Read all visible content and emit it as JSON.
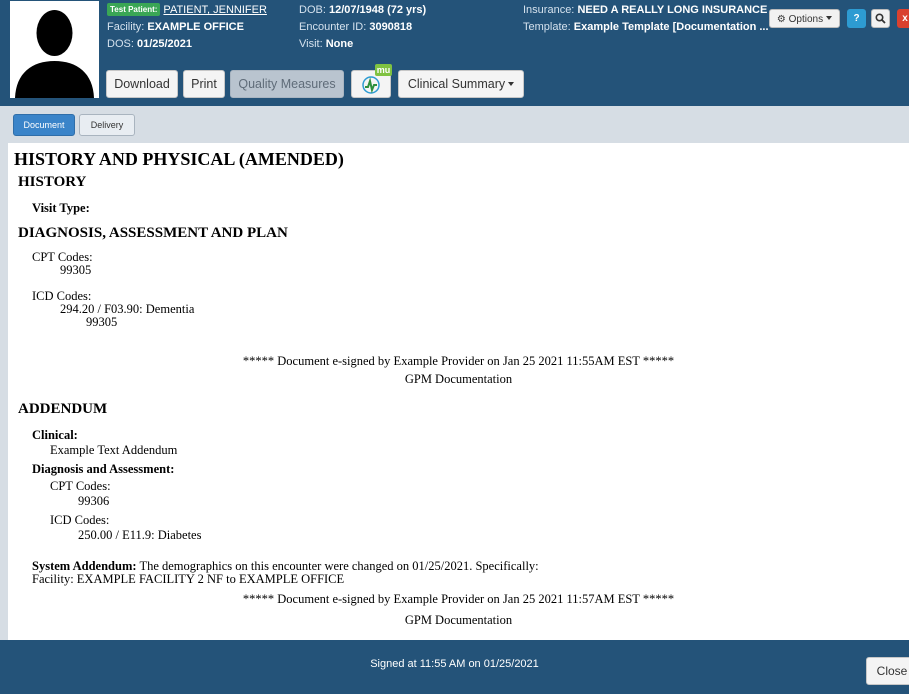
{
  "header": {
    "badge": "Test Patient:",
    "patient_name": "PATIENT, JENNIFER",
    "facility_label": "Facility:",
    "facility_value": "EXAMPLE OFFICE",
    "dos_label": "DOS:",
    "dos_value": "01/25/2021",
    "dob_label": "DOB:",
    "dob_value": "12/07/1948 (72 yrs)",
    "encounter_label": "Encounter ID:",
    "encounter_value": "3090818",
    "visit_label": "Visit:",
    "visit_value": "None",
    "insurance_label": "Insurance:",
    "insurance_value": "NEED A REALLY LONG INSURANCE",
    "template_label": "Template:",
    "template_value": "Example Template [Documentation ...",
    "options_label": "Options",
    "help_label": "?",
    "close_x_label": "x",
    "buttons": {
      "download": "Download",
      "print": "Print",
      "quality_measures": "Quality Measures",
      "mu_badge": "mu",
      "clinical_summary": "Clinical Summary"
    }
  },
  "tabs": {
    "document": "Document",
    "delivery": "Delivery"
  },
  "document": {
    "title": "HISTORY AND PHYSICAL (AMENDED)",
    "history_heading": "HISTORY",
    "visit_type_label": "Visit Type:",
    "dap_heading": "DIAGNOSIS, ASSESSMENT AND PLAN",
    "cpt_label": "CPT Codes:",
    "cpt_value": "99305",
    "icd_label": "ICD Codes:",
    "icd_value": "294.20 / F03.90: Dementia",
    "icd_sub_value": "99305",
    "esign_1": "***** Document e-signed by Example Provider on Jan 25 2021 11:55AM EST *****",
    "gpm_1": "GPM Documentation",
    "addendum_heading": "ADDENDUM",
    "clinical_label": "Clinical:",
    "clinical_value": "Example Text Addendum",
    "dx_assess_label": "Diagnosis and Assessment:",
    "add_cpt_label": "CPT Codes:",
    "add_cpt_value": "99306",
    "add_icd_label": "ICD Codes:",
    "add_icd_value": "250.00 / E11.9: Diabetes",
    "system_addendum_label": "System Addendum:",
    "system_addendum_text": "The demographics on this encounter were changed on 01/25/2021. Specifically:",
    "facility_change": "Facility: EXAMPLE FACILITY 2 NF to EXAMPLE OFFICE",
    "esign_2": "***** Document e-signed by Example Provider on Jan 25 2021 11:57AM EST *****",
    "gpm_2": "GPM Documentation"
  },
  "footer": {
    "signed_text": "Signed at 11:55 AM on 01/25/2021",
    "close_label": "Close"
  }
}
